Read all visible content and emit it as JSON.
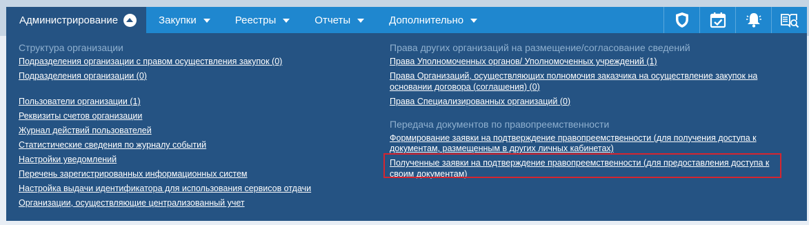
{
  "nav": {
    "items": [
      {
        "label": "Администрирование"
      },
      {
        "label": "Закупки"
      },
      {
        "label": "Реестры"
      },
      {
        "label": "Отчеты"
      },
      {
        "label": "Дополнительно"
      }
    ],
    "icons": [
      "shield-icon",
      "calendar-check-icon",
      "bell-icon",
      "book-search-icon"
    ]
  },
  "left": {
    "section_title": "Структура организации",
    "group1": [
      "Подразделения организации с правом осуществления закупок (0)",
      "Подразделения организации (0)"
    ],
    "group2": [
      "Пользователи организации (1)",
      "Реквизиты счетов организации",
      "Журнал действий пользователей",
      "Статистические сведения по журналу событий",
      "Настройки уведомлений",
      "Перечень зарегистрированных информационных систем",
      "Настройка выдачи идентификатора для использования сервисов отдачи",
      "Организации, осуществляющие централизованный учет"
    ]
  },
  "right": {
    "section1_title": "Права других организаций на размещение/согласование сведений",
    "section1_links": [
      "Права Уполномоченных органов/ Уполномоченных учреждений (1)",
      "Права Организаций, осуществляющих полномочия заказчика на осуществление закупок на основании договора (соглашения) (0)",
      "Права Специализированных организаций (0)"
    ],
    "section2_title": "Передача документов по правопреемственности",
    "section2_links": [
      "Формирование заявки на подтверждение правопреемственности (для получения доступа к документам, размещенным в других личных кабинетах)",
      "Полученные заявки на подтверждение правопреемственности (для предоставления доступа к своим документам)"
    ]
  },
  "colors": {
    "nav_bg": "#1f87cf",
    "active_bg": "#255383",
    "panel_bg": "#255383",
    "section_title": "#8fb0cf",
    "highlight": "#d6252f"
  }
}
